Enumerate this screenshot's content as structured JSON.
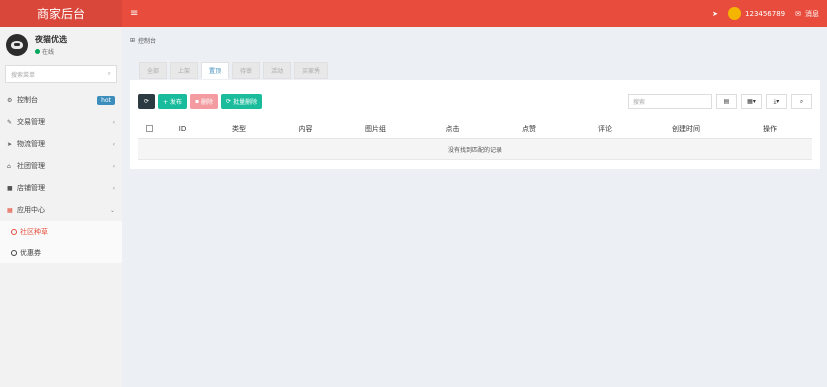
{
  "header": {
    "brand": "商家后台",
    "menu_toggle": "≡",
    "send_icon": "➤",
    "username": "123456789",
    "message_icon": "✉",
    "message_label": "消息"
  },
  "sidebar": {
    "user": {
      "name": "夜猫优选",
      "status": "在线"
    },
    "search_placeholder": "搜索菜单",
    "items": [
      {
        "icon": "⚙",
        "label": "控制台",
        "badge": "hot"
      },
      {
        "icon": "✎",
        "label": "交易管理",
        "arrow": "‹"
      },
      {
        "icon": "➤",
        "label": "物流管理",
        "arrow": "‹"
      },
      {
        "icon": "⌂",
        "label": "社团管理",
        "arrow": "‹"
      },
      {
        "icon": "■",
        "label": "店铺管理",
        "arrow": "‹"
      },
      {
        "icon": "▦",
        "label": "应用中心",
        "arrow": "⌄"
      }
    ],
    "sub_items": [
      {
        "label": "社区种草",
        "active": true
      },
      {
        "label": "优惠券",
        "active": false
      }
    ]
  },
  "main": {
    "breadcrumb": {
      "icon": "⊞",
      "label": "控制台"
    },
    "tabs": [
      "全部",
      "上架",
      "置顶",
      "待审",
      "活动",
      "买家秀"
    ],
    "toolbar": {
      "refresh": "⟳",
      "publish": "+ 发布",
      "delete": "删除",
      "batch": "批量删除"
    },
    "search_placeholder": "搜索",
    "columns": [
      "ID",
      "类型",
      "内容",
      "图片组",
      "点击",
      "点赞",
      "评论",
      "创建时间",
      "操作"
    ],
    "empty_message": "没有找到匹配的记录"
  },
  "colors": {
    "brand": "#e74c3c",
    "accent": "#3c8dbc",
    "success": "#18bc9c"
  }
}
